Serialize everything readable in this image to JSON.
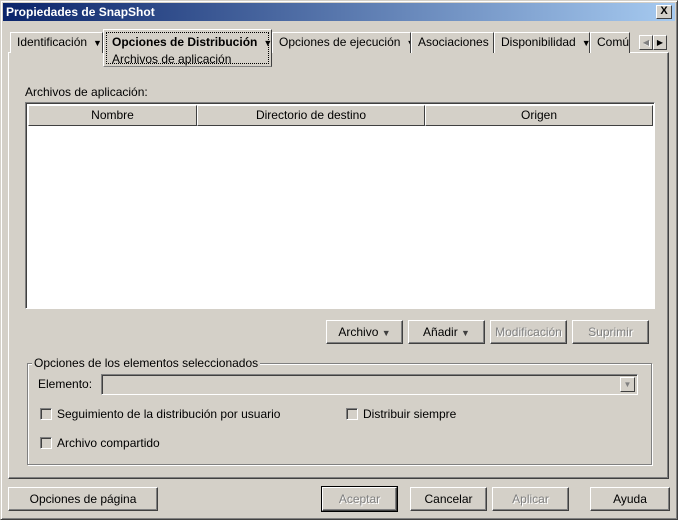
{
  "window": {
    "title": "Propiedades de SnapShot",
    "close": "X"
  },
  "tabs": [
    {
      "label": "Identificación",
      "arrow": "▼"
    },
    {
      "label": "Opciones de Distribución",
      "arrow": "▼",
      "sub": "Archivos de aplicación"
    },
    {
      "label": "Opciones de ejecución",
      "arrow": "▼"
    },
    {
      "label": "Asociaciones"
    },
    {
      "label": "Disponibilidad",
      "arrow": "▼"
    },
    {
      "label": "Común"
    }
  ],
  "tab_scroll": {
    "left": "◀",
    "right": "▶"
  },
  "files": {
    "label": "Archivos de aplicación:",
    "columns": [
      "Nombre",
      "Directorio de destino",
      "Origen"
    ],
    "rows": []
  },
  "list_buttons": {
    "archivo": "Archivo",
    "anadir": "Añadir",
    "modificacion": "Modificación",
    "suprimir": "Suprimir",
    "arrow": "▼"
  },
  "group": {
    "title": "Opciones de los elementos seleccionados",
    "element_label": "Elemento:",
    "element_value": "",
    "combo_arrow": "▼",
    "checkboxes": [
      {
        "label": "Seguimiento de la distribución por usuario",
        "checked": false
      },
      {
        "label": "Distribuir siempre",
        "checked": false
      },
      {
        "label": "Archivo compartido",
        "checked": false
      }
    ]
  },
  "footer": {
    "page_options": "Opciones de página",
    "ok": "Aceptar",
    "cancel": "Cancelar",
    "apply": "Aplicar",
    "help": "Ayuda"
  }
}
